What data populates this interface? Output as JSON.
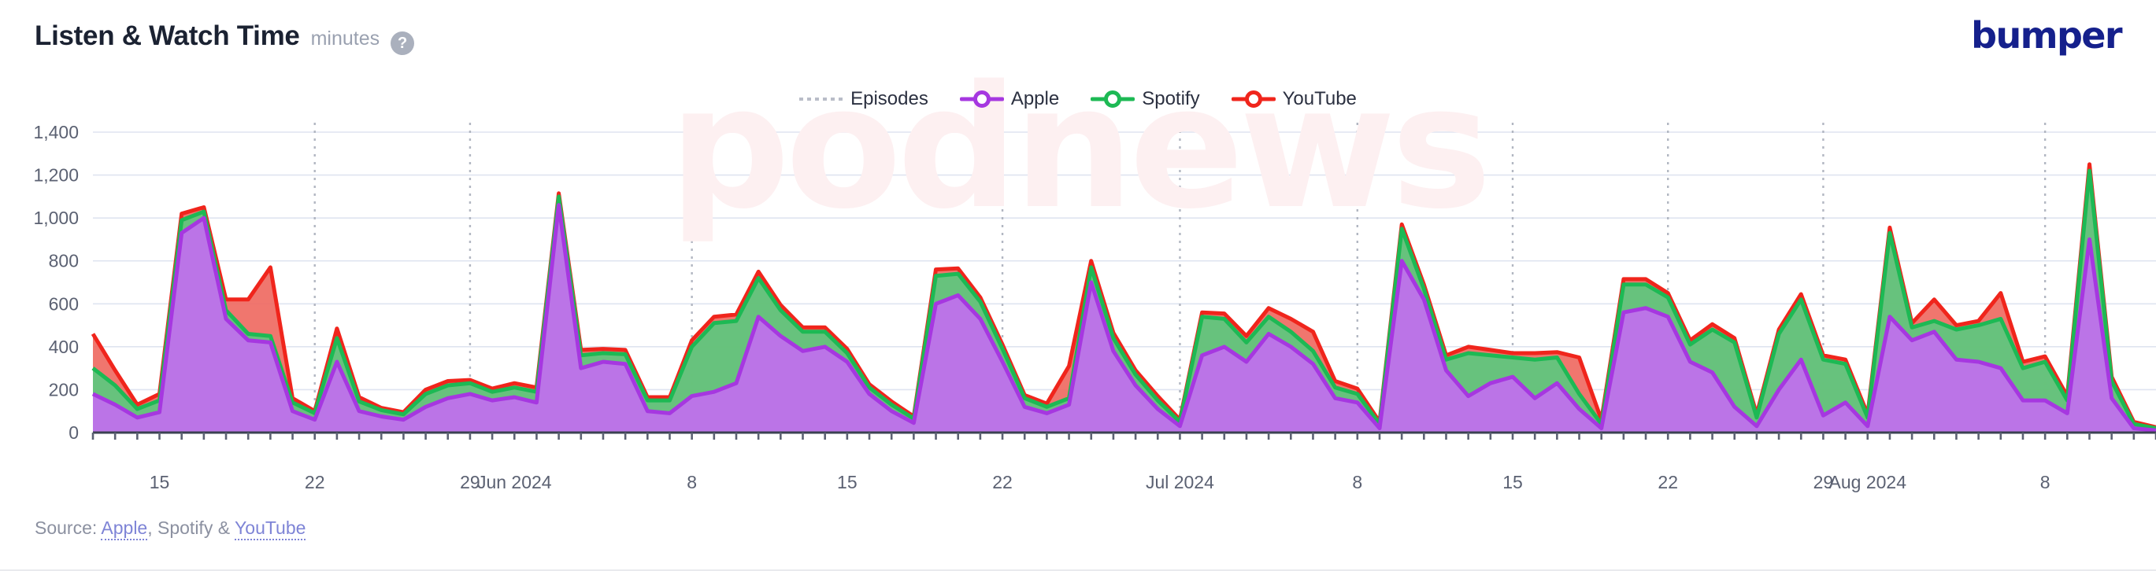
{
  "header": {
    "title": "Listen & Watch Time",
    "unit": "minutes",
    "help_icon_glyph": "?",
    "help_icon_name": "question-mark-icon",
    "brand": "bumper",
    "brand_color": "#15208c"
  },
  "watermark": {
    "text": "podnews"
  },
  "legend": {
    "items": [
      {
        "label": "Episodes",
        "color": "#b9bdc8",
        "style": "dotted"
      },
      {
        "label": "Apple",
        "color": "#a637e0",
        "style": "line-marker"
      },
      {
        "label": "Spotify",
        "color": "#1db954",
        "style": "line-marker"
      },
      {
        "label": "YouTube",
        "color": "#f0251c",
        "style": "line-marker"
      }
    ]
  },
  "footer": {
    "prefix": "Source: ",
    "link1": "Apple",
    "sep1": ", ",
    "plain": "Spotify",
    "sep2": " & ",
    "link2": "YouTube"
  },
  "chart_data": {
    "type": "area",
    "stacked": true,
    "title": "Listen & Watch Time",
    "subtitle": "minutes",
    "xlabel": "",
    "ylabel": "minutes",
    "ylim": [
      0,
      1400
    ],
    "yticks": [
      "0",
      "200",
      "400",
      "600",
      "800",
      "1,000",
      "1,200",
      "1,400"
    ],
    "ytick_values": [
      0,
      200,
      400,
      600,
      800,
      1000,
      1200,
      1400
    ],
    "grid": true,
    "legend_position": "top-center",
    "xticks": [
      {
        "label": "15",
        "index": 3
      },
      {
        "label": "22",
        "index": 10
      },
      {
        "label": "29",
        "index": 17
      },
      {
        "label": "Jun 2024",
        "index": 19
      },
      {
        "label": "8",
        "index": 27
      },
      {
        "label": "15",
        "index": 34
      },
      {
        "label": "22",
        "index": 41
      },
      {
        "label": "Jul 2024",
        "index": 49
      },
      {
        "label": "8",
        "index": 57
      },
      {
        "label": "15",
        "index": 64
      },
      {
        "label": "22",
        "index": 71
      },
      {
        "label": "29",
        "index": 78
      },
      {
        "label": "Aug 2024",
        "index": 80
      },
      {
        "label": "8",
        "index": 88
      }
    ],
    "episode_markers": [
      10,
      17,
      27,
      41,
      49,
      57,
      64,
      71,
      78,
      88
    ],
    "series": [
      {
        "name": "Apple",
        "color": "#a637e0",
        "fill": "#c26ef0",
        "values": [
          180,
          130,
          70,
          95,
          930,
          1000,
          530,
          430,
          420,
          100,
          60,
          330,
          100,
          75,
          60,
          120,
          160,
          180,
          150,
          165,
          140,
          1060,
          300,
          330,
          320,
          100,
          90,
          170,
          190,
          230,
          540,
          450,
          380,
          400,
          330,
          180,
          100,
          45,
          600,
          640,
          530,
          330,
          120,
          90,
          130,
          700,
          380,
          220,
          110,
          30,
          360,
          400,
          330,
          460,
          400,
          320,
          160,
          140,
          20,
          800,
          620,
          290,
          170,
          230,
          260,
          160,
          230,
          110,
          20,
          560,
          580,
          540,
          330,
          280,
          120,
          30,
          200,
          340,
          80,
          140,
          30,
          540,
          430,
          470,
          340,
          330,
          300,
          150,
          150,
          90,
          900,
          160,
          20,
          10
        ]
      },
      {
        "name": "Spotify",
        "color": "#1db954",
        "fill": "#5bc97e",
        "values": [
          120,
          90,
          40,
          55,
          60,
          30,
          40,
          30,
          30,
          40,
          30,
          110,
          45,
          30,
          25,
          60,
          60,
          50,
          40,
          45,
          50,
          40,
          60,
          40,
          45,
          50,
          60,
          230,
          320,
          290,
          180,
          120,
          90,
          70,
          40,
          30,
          30,
          20,
          130,
          100,
          80,
          60,
          40,
          30,
          30,
          70,
          60,
          50,
          40,
          20,
          180,
          130,
          90,
          80,
          70,
          60,
          50,
          40,
          20,
          150,
          50,
          50,
          200,
          130,
          90,
          180,
          120,
          70,
          20,
          130,
          110,
          90,
          80,
          200,
          300,
          40,
          260,
          280,
          260,
          180,
          40,
          390,
          60,
          50,
          140,
          170,
          230,
          150,
          180,
          60,
          320,
          80,
          20,
          10
        ]
      },
      {
        "name": "YouTube",
        "color": "#f0251c",
        "fill": "#ef6a62",
        "values": [
          160,
          70,
          20,
          30,
          30,
          20,
          50,
          160,
          320,
          20,
          10,
          45,
          20,
          10,
          10,
          20,
          20,
          15,
          15,
          20,
          20,
          15,
          25,
          20,
          20,
          15,
          15,
          30,
          30,
          30,
          30,
          25,
          20,
          20,
          20,
          15,
          15,
          10,
          30,
          25,
          20,
          20,
          15,
          15,
          150,
          30,
          25,
          20,
          20,
          10,
          20,
          25,
          30,
          40,
          60,
          90,
          30,
          25,
          10,
          20,
          20,
          20,
          30,
          25,
          20,
          30,
          25,
          170,
          20,
          25,
          25,
          20,
          20,
          25,
          20,
          15,
          20,
          25,
          20,
          20,
          15,
          25,
          20,
          100,
          20,
          20,
          120,
          30,
          25,
          20,
          30,
          20,
          10,
          5
        ]
      }
    ]
  }
}
